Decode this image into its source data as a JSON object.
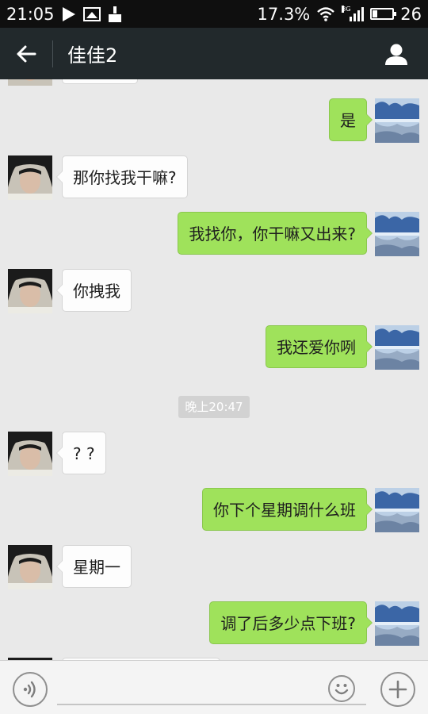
{
  "status_bar": {
    "time": "21:05",
    "data_rate": "17.3%",
    "network_type": "3G",
    "battery_level": "26",
    "battery_fraction": 0.26,
    "icons": [
      "play-icon",
      "image-icon",
      "broom-icon",
      "wifi-icon",
      "signal-icon",
      "battery-icon"
    ]
  },
  "header": {
    "title": "佳佳2",
    "back_icon": "arrow-left-icon",
    "profile_icon": "person-icon"
  },
  "conversation": {
    "messages": [
      {
        "id": "m1",
        "direction": "outgoing",
        "text": "是"
      },
      {
        "id": "m2",
        "direction": "incoming",
        "text": "那你找我干嘛?"
      },
      {
        "id": "m3",
        "direction": "outgoing",
        "text": "我找你，你干嘛又出来?"
      },
      {
        "id": "m4",
        "direction": "incoming",
        "text": "你拽我"
      },
      {
        "id": "m5",
        "direction": "outgoing",
        "text": "我还爱你咧"
      },
      {
        "id": "m6",
        "direction": "incoming",
        "text": "? ?"
      },
      {
        "id": "m7",
        "direction": "outgoing",
        "text": "你下个星期调什么班"
      },
      {
        "id": "m8",
        "direction": "incoming",
        "text": "星期一"
      },
      {
        "id": "m9",
        "direction": "outgoing",
        "text": "调了后多少点下班?"
      }
    ],
    "timestamp": "晚上20:47"
  },
  "input_bar": {
    "voice_icon": "voice-icon",
    "text_value": "",
    "emoji_icon": "smiley-icon",
    "plus_icon": "plus-icon"
  },
  "colors": {
    "status_bar_bg": "#0f0f0f",
    "header_bg": "#22292c",
    "chat_bg": "#e9e9e9",
    "outgoing_bubble": "#9fe25b",
    "incoming_bubble": "#fdfdfd",
    "timestamp_bg": "#d2d2d2"
  }
}
